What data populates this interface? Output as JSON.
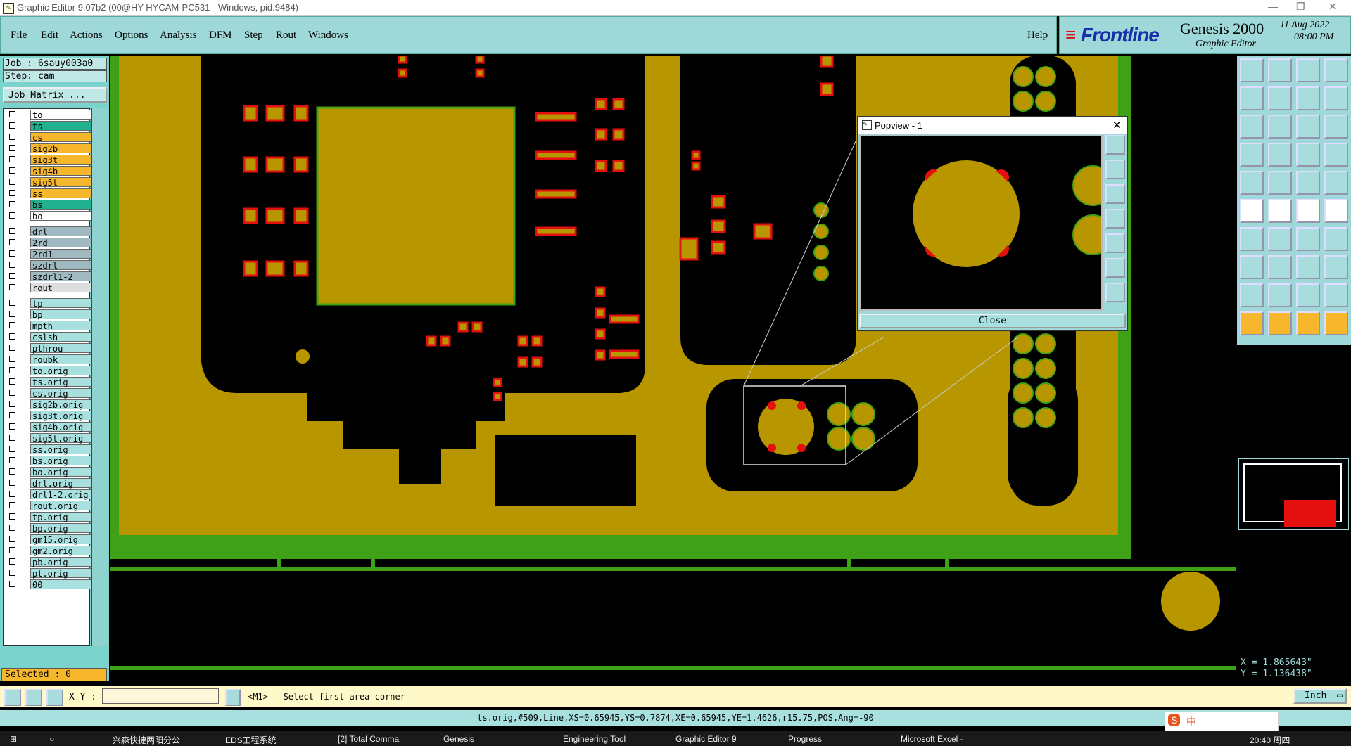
{
  "titlebar": {
    "title": "Graphic Editor 9.07b2 (00@HY-HYCAM-PC531 - Windows, pid:9484)"
  },
  "menu": {
    "items": [
      "File",
      "Edit",
      "Actions",
      "Options",
      "Analysis",
      "DFM",
      "Step",
      "Rout",
      "Windows"
    ],
    "help": "Help"
  },
  "logo": {
    "brand": "Frontline",
    "product": "Genesis 2000",
    "subtitle": "Graphic Editor",
    "date": "11 Aug 2022",
    "time": "08:00 PM"
  },
  "job": {
    "job_label": "Job : 6sauy003a0",
    "step_label": "Step: cam",
    "matrix_button": "Job Matrix ..."
  },
  "layers_group1": [
    {
      "name": "to",
      "color": "#ffffff"
    },
    {
      "name": "ts",
      "color": "#20b28e"
    },
    {
      "name": "cs",
      "color": "#f7b72c"
    },
    {
      "name": "sig2b",
      "color": "#f7b72c"
    },
    {
      "name": "sig3t",
      "color": "#f7b72c"
    },
    {
      "name": "sig4b",
      "color": "#f7b72c"
    },
    {
      "name": "sig5t",
      "color": "#f7b72c"
    },
    {
      "name": "ss",
      "color": "#f7b72c"
    },
    {
      "name": "bs",
      "color": "#20b28e"
    },
    {
      "name": "bo",
      "color": "#ffffff"
    }
  ],
  "layers_group2": [
    {
      "name": "drl",
      "color": "#a0b8c0"
    },
    {
      "name": "2rd",
      "color": "#a0b8c0"
    },
    {
      "name": "2rd1",
      "color": "#a0b8c0"
    },
    {
      "name": "szdrl",
      "color": "#a0b8c0"
    },
    {
      "name": "szdrl1-2",
      "color": "#a0b8c0"
    },
    {
      "name": "rout",
      "color": "#dddddd"
    }
  ],
  "layers_group3": [
    {
      "name": "tp",
      "color": "#a8e0e0"
    },
    {
      "name": "bp",
      "color": "#a8e0e0"
    },
    {
      "name": "mpth",
      "color": "#a8e0e0"
    },
    {
      "name": "cslsh",
      "color": "#a8e0e0"
    },
    {
      "name": "pthrou",
      "color": "#a8e0e0"
    },
    {
      "name": "roubk",
      "color": "#a8e0e0"
    },
    {
      "name": "to.orig",
      "color": "#a8e0e0"
    },
    {
      "name": "ts.orig",
      "color": "#a8e0e0"
    },
    {
      "name": "cs.orig",
      "color": "#a8e0e0"
    },
    {
      "name": "sig2b.orig",
      "color": "#a8e0e0"
    },
    {
      "name": "sig3t.orig",
      "color": "#a8e0e0"
    },
    {
      "name": "sig4b.orig",
      "color": "#a8e0e0"
    },
    {
      "name": "sig5t.orig",
      "color": "#a8e0e0"
    },
    {
      "name": "ss.orig",
      "color": "#a8e0e0"
    },
    {
      "name": "bs.orig",
      "color": "#a8e0e0"
    },
    {
      "name": "bo.orig",
      "color": "#a8e0e0"
    },
    {
      "name": "drl.orig",
      "color": "#a8e0e0"
    },
    {
      "name": "drl1-2.orig",
      "color": "#a8e0e0"
    },
    {
      "name": "rout.orig",
      "color": "#a8e0e0"
    },
    {
      "name": "tp.orig",
      "color": "#a8e0e0"
    },
    {
      "name": "bp.orig",
      "color": "#a8e0e0"
    },
    {
      "name": "gm15.orig",
      "color": "#a8e0e0"
    },
    {
      "name": "gm2.orig",
      "color": "#a8e0e0"
    },
    {
      "name": "pb.orig",
      "color": "#a8e0e0"
    },
    {
      "name": "pt.orig",
      "color": "#a8e0e0"
    },
    {
      "name": "00",
      "color": "#a8e0e0"
    }
  ],
  "popview": {
    "title": "Popview - 1",
    "close_label": "Close"
  },
  "coords": {
    "x": "X = 1.865643\"",
    "y": "Y = 1.136438\""
  },
  "selected": "Selected : 0",
  "cmd": {
    "xy_label": "X Y :",
    "prompt": "<M1> - Select first area corner",
    "unit": "Inch"
  },
  "status": "ts.orig,#509,Line,XS=0.65945,YS=0.7874,XE=0.65945,YE=1.4626,r15.75,POS,Ang=-90",
  "taskbar": {
    "items": [
      "兴森快捷两阳分公",
      "EDS工程系统",
      "[2] Total Comma",
      "Genesis",
      "Engineering Tool",
      "Graphic Editor 9",
      "Progress",
      "Microsoft Excel -"
    ],
    "clock": "20:40 周四"
  },
  "colors": {
    "copper": "#b89600",
    "pad_red": "#e41010",
    "board_green": "#3fa118",
    "panel_cyan": "#9fd8d8"
  }
}
